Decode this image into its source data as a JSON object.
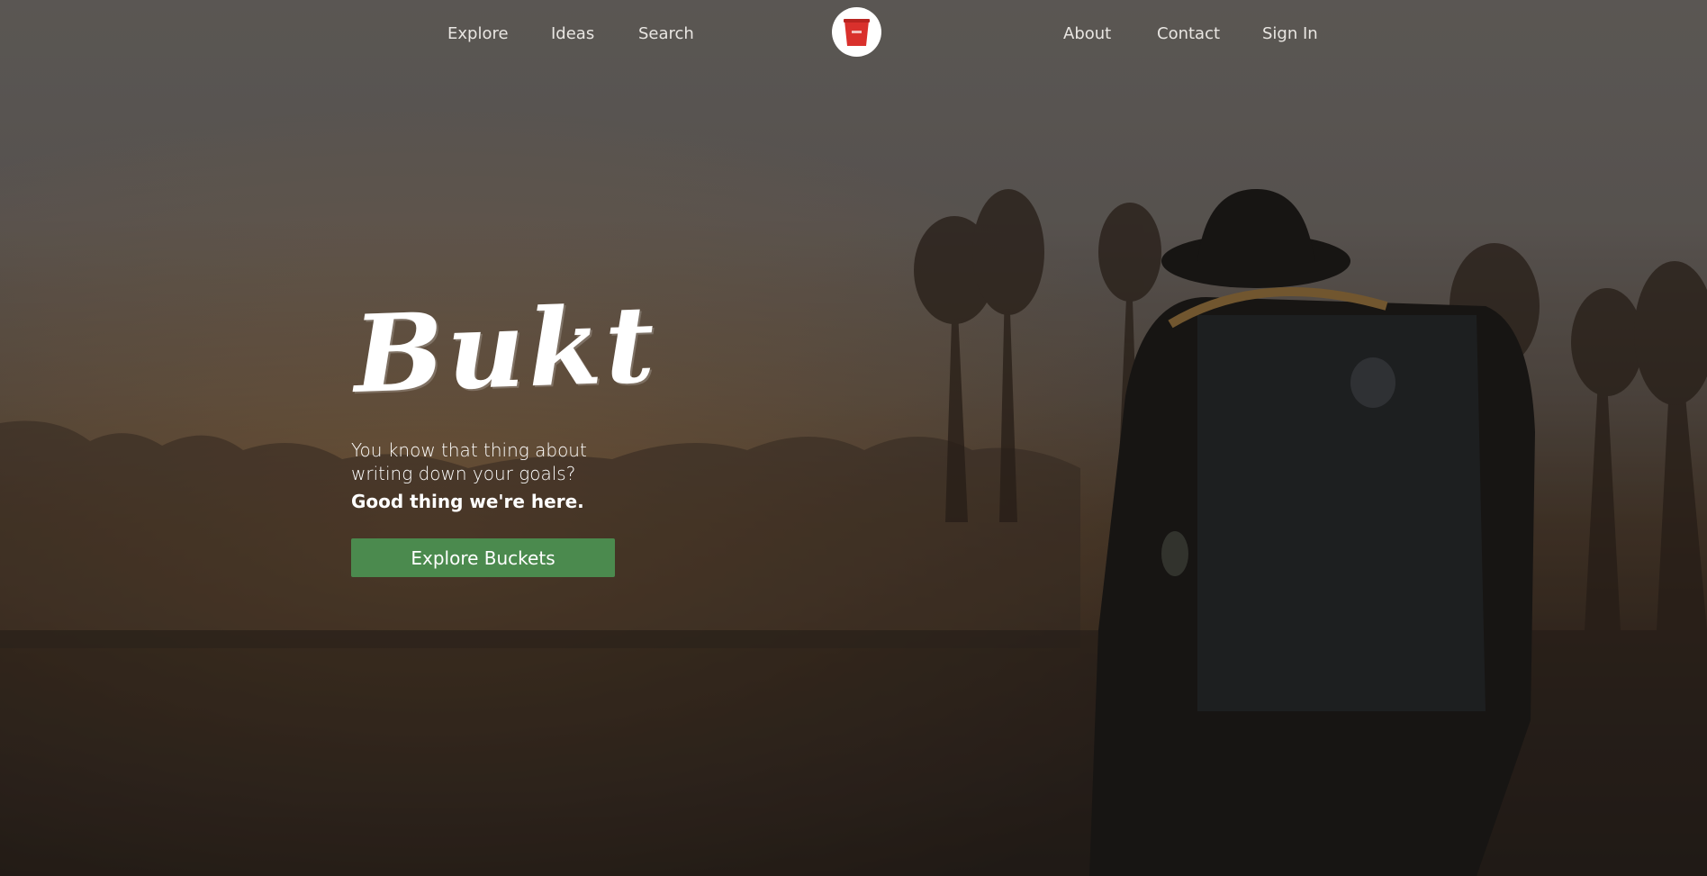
{
  "nav": {
    "left_links": [
      "Explore",
      "Ideas",
      "Search"
    ],
    "right_links": [
      "About",
      "Contact",
      "Sign In"
    ],
    "logo_icon": "bucket-icon"
  },
  "hero": {
    "brand": "Bukt",
    "tagline_line1": "You know that thing about",
    "tagline_line2": "writing down your goals?",
    "tagline_bold": "Good thing we're here.",
    "cta_label": "Explore Buckets",
    "background": "hiker-with-backpack-in-misty-field-photo"
  },
  "colors": {
    "cta": "#4b8a4e",
    "logo_bucket": "#d9302c",
    "nav_text": "#e9e6e2"
  }
}
